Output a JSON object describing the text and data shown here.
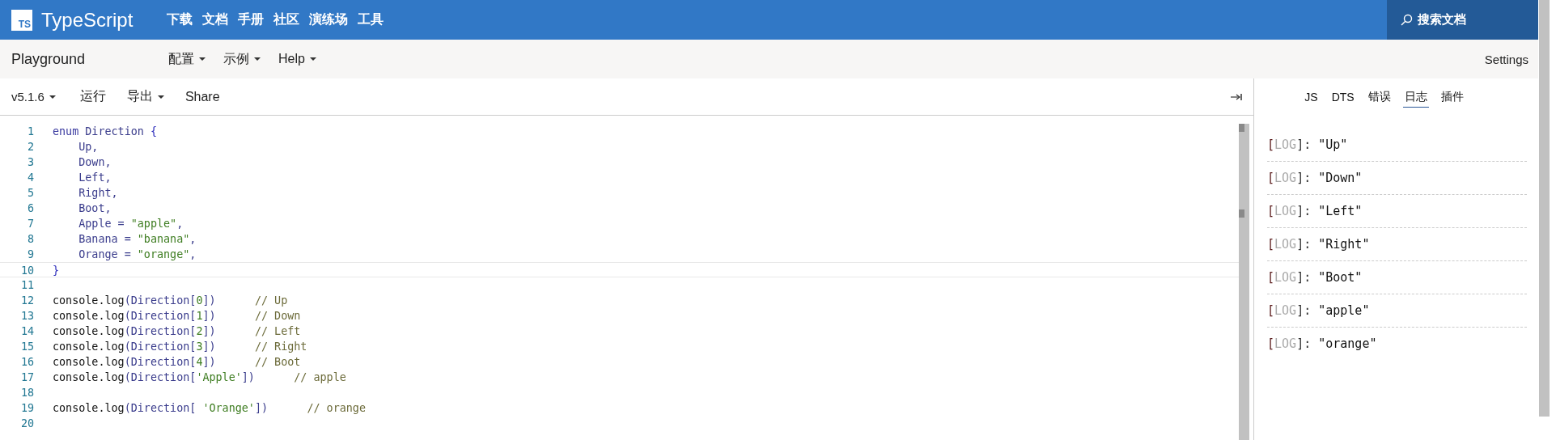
{
  "header": {
    "logo_text": "TS",
    "brand": "TypeScript",
    "nav": [
      "下载",
      "文档",
      "手册",
      "社区",
      "演练场",
      "工具"
    ],
    "search": {
      "label": "搜索文档"
    }
  },
  "subbar": {
    "title": "Playground",
    "menus": [
      {
        "label": "配置",
        "has_menu": true
      },
      {
        "label": "示例",
        "has_menu": true
      },
      {
        "label": "Help",
        "has_menu": true
      }
    ],
    "settings": "Settings"
  },
  "toolbar": {
    "items": [
      {
        "label": "v5.1.6",
        "has_menu": true,
        "kind": "version"
      },
      {
        "label": "运行",
        "has_menu": false,
        "kind": "action"
      },
      {
        "label": "导出",
        "has_menu": true,
        "kind": "action"
      },
      {
        "label": "Share",
        "has_menu": false,
        "kind": "action"
      }
    ]
  },
  "editor": {
    "lines": [
      {
        "number": "1",
        "current": false,
        "tokens": [
          {
            "kind": "keyword",
            "text": "enum "
          },
          {
            "kind": "ident",
            "text": "Direction "
          },
          {
            "kind": "brace",
            "text": "{"
          }
        ]
      },
      {
        "number": "2",
        "current": false,
        "tokens": [
          {
            "kind": "ident",
            "text": "    Up,"
          }
        ]
      },
      {
        "number": "3",
        "current": false,
        "tokens": [
          {
            "kind": "ident",
            "text": "    Down,"
          }
        ]
      },
      {
        "number": "4",
        "current": false,
        "tokens": [
          {
            "kind": "ident",
            "text": "    Left,"
          }
        ]
      },
      {
        "number": "5",
        "current": false,
        "tokens": [
          {
            "kind": "ident",
            "text": "    Right,"
          }
        ]
      },
      {
        "number": "6",
        "current": false,
        "tokens": [
          {
            "kind": "ident",
            "text": "    Boot,"
          }
        ]
      },
      {
        "number": "7",
        "current": false,
        "tokens": [
          {
            "kind": "ident",
            "text": "    Apple = "
          },
          {
            "kind": "string",
            "text": "\"apple\""
          },
          {
            "kind": "ident",
            "text": ","
          }
        ]
      },
      {
        "number": "8",
        "current": false,
        "tokens": [
          {
            "kind": "ident",
            "text": "    Banana = "
          },
          {
            "kind": "string",
            "text": "\"banana\""
          },
          {
            "kind": "ident",
            "text": ","
          }
        ]
      },
      {
        "number": "9",
        "current": false,
        "tokens": [
          {
            "kind": "ident",
            "text": "    Orange = "
          },
          {
            "kind": "string",
            "text": "\"orange\""
          },
          {
            "kind": "ident",
            "text": ","
          }
        ]
      },
      {
        "number": "10",
        "current": true,
        "tokens": [
          {
            "kind": "brace",
            "text": "}"
          }
        ]
      },
      {
        "number": "11",
        "current": false
      },
      {
        "number": "12",
        "current": false,
        "tokens": [
          {
            "kind": "plain",
            "text": "console.log"
          },
          {
            "kind": "ident",
            "text": "(Direction["
          },
          {
            "kind": "string",
            "text": "0"
          },
          {
            "kind": "ident",
            "text": "])"
          },
          {
            "kind": "comment",
            "text": "      // Up"
          }
        ]
      },
      {
        "number": "13",
        "current": false,
        "tokens": [
          {
            "kind": "plain",
            "text": "console.log"
          },
          {
            "kind": "ident",
            "text": "(Direction["
          },
          {
            "kind": "string",
            "text": "1"
          },
          {
            "kind": "ident",
            "text": "])"
          },
          {
            "kind": "comment",
            "text": "      // Down"
          }
        ]
      },
      {
        "number": "14",
        "current": false,
        "tokens": [
          {
            "kind": "plain",
            "text": "console.log"
          },
          {
            "kind": "ident",
            "text": "(Direction["
          },
          {
            "kind": "string",
            "text": "2"
          },
          {
            "kind": "ident",
            "text": "])"
          },
          {
            "kind": "comment",
            "text": "      // Left"
          }
        ]
      },
      {
        "number": "15",
        "current": false,
        "tokens": [
          {
            "kind": "plain",
            "text": "console.log"
          },
          {
            "kind": "ident",
            "text": "(Direction["
          },
          {
            "kind": "string",
            "text": "3"
          },
          {
            "kind": "ident",
            "text": "])"
          },
          {
            "kind": "comment",
            "text": "      // Right"
          }
        ]
      },
      {
        "number": "16",
        "current": false,
        "tokens": [
          {
            "kind": "plain",
            "text": "console.log"
          },
          {
            "kind": "ident",
            "text": "(Direction["
          },
          {
            "kind": "string",
            "text": "4"
          },
          {
            "kind": "ident",
            "text": "])"
          },
          {
            "kind": "comment",
            "text": "      // Boot"
          }
        ]
      },
      {
        "number": "17",
        "current": false,
        "tokens": [
          {
            "kind": "plain",
            "text": "console.log"
          },
          {
            "kind": "ident",
            "text": "(Direction["
          },
          {
            "kind": "string",
            "text": "'Apple'"
          },
          {
            "kind": "ident",
            "text": "])"
          },
          {
            "kind": "comment",
            "text": "      // apple"
          }
        ]
      },
      {
        "number": "18",
        "current": false
      },
      {
        "number": "19",
        "current": false,
        "tokens": [
          {
            "kind": "plain",
            "text": "console.log"
          },
          {
            "kind": "ident",
            "text": "(Direction[ "
          },
          {
            "kind": "string",
            "text": "'Orange'"
          },
          {
            "kind": "ident",
            "text": "])"
          },
          {
            "kind": "comment",
            "text": "      // orange"
          }
        ]
      },
      {
        "number": "20",
        "current": false
      }
    ]
  },
  "output": {
    "tabs": [
      {
        "label": "JS",
        "selected": false
      },
      {
        "label": "DTS",
        "selected": false
      },
      {
        "label": "错误",
        "selected": false
      },
      {
        "label": "日志",
        "selected": true
      },
      {
        "label": "插件",
        "selected": false
      }
    ],
    "logs": [
      {
        "open": "[",
        "tag": "LOG",
        "close": "]:",
        "value": "\"Up\""
      },
      {
        "open": "[",
        "tag": "LOG",
        "close": "]:",
        "value": "\"Down\""
      },
      {
        "open": "[",
        "tag": "LOG",
        "close": "]:",
        "value": "\"Left\""
      },
      {
        "open": "[",
        "tag": "LOG",
        "close": "]:",
        "value": "\"Right\""
      },
      {
        "open": "[",
        "tag": "LOG",
        "close": "]:",
        "value": "\"Boot\""
      },
      {
        "open": "[",
        "tag": "LOG",
        "close": "]:",
        "value": "\"apple\""
      },
      {
        "open": "[",
        "tag": "LOG",
        "close": "]:",
        "value": "\"orange\""
      }
    ]
  }
}
